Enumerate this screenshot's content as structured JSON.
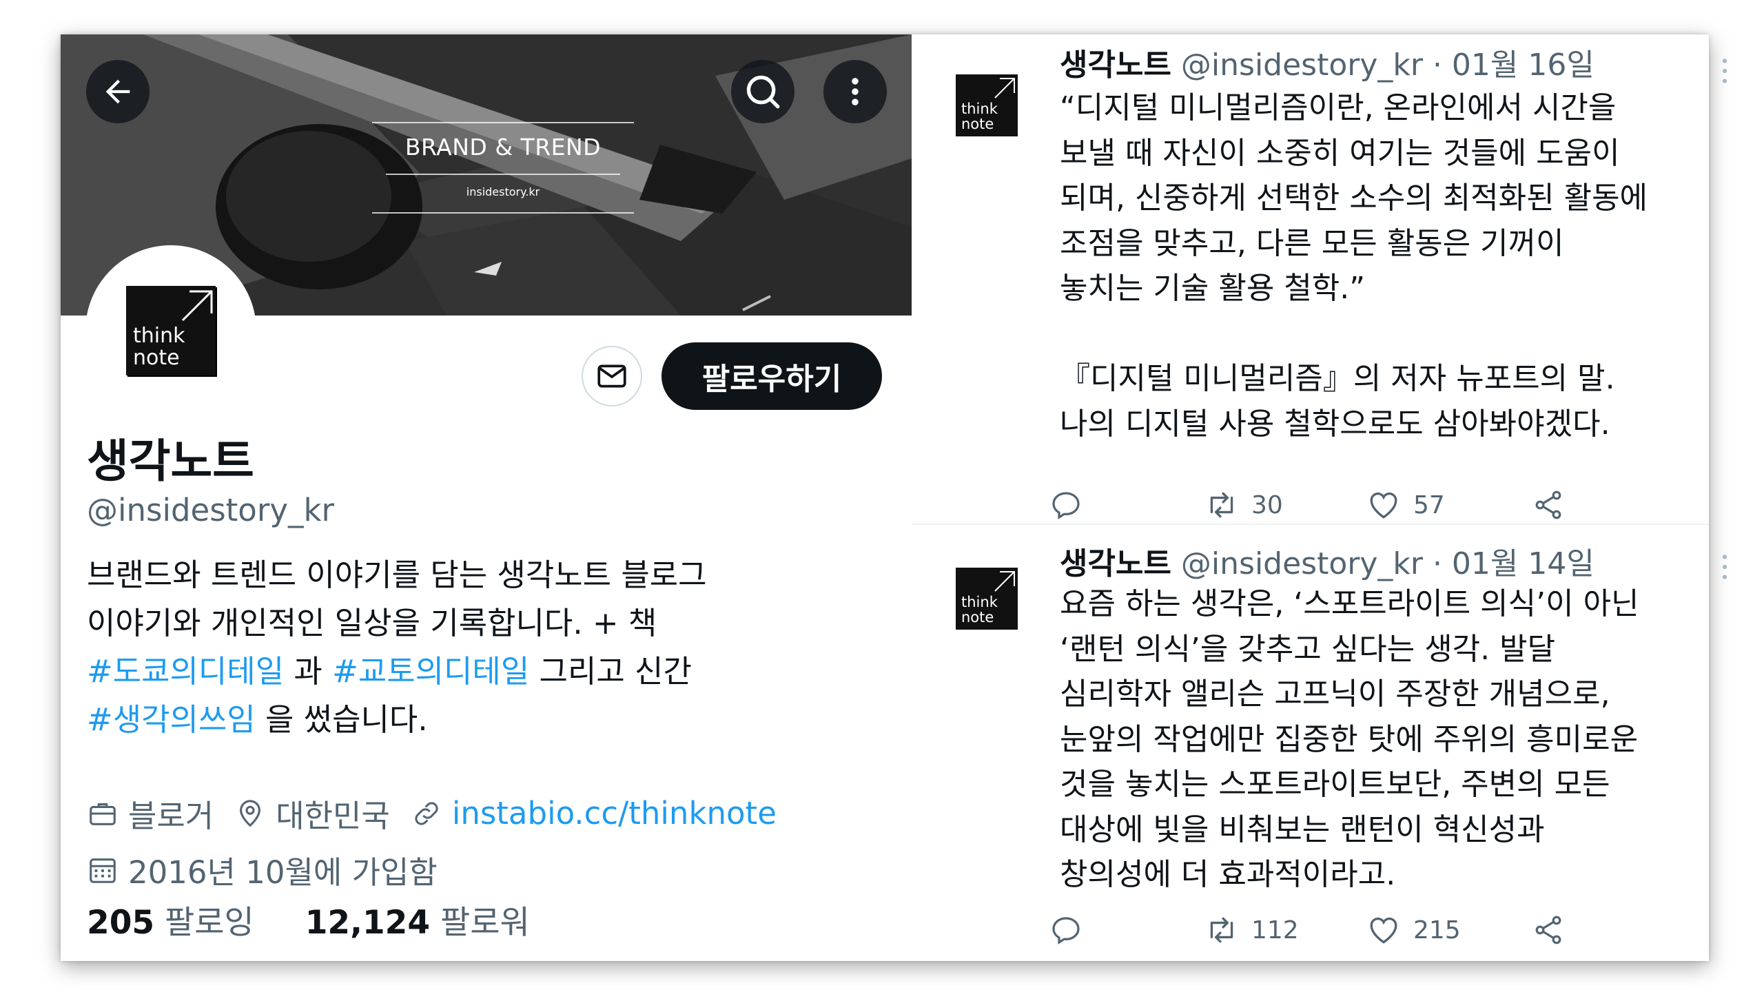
{
  "banner": {
    "title": "BRAND & TREND",
    "subtitle": "insidestory.kr"
  },
  "header_buttons": {
    "back_icon": "arrow-left-icon",
    "search_icon": "search-icon",
    "more_icon": "more-vertical-icon"
  },
  "avatar": {
    "logo_line1": "think",
    "logo_line2": "note"
  },
  "actions": {
    "message_icon": "mail-icon",
    "follow_label": "팔로우하기"
  },
  "profile": {
    "display_name": "생각노트",
    "handle": "@insidestory_kr",
    "bio": {
      "line1": "브랜드와 트렌드 이야기를 담는 생각노트 블로그",
      "line2": "이야기와 개인적인 일상을 기록합니다. + 책",
      "tag1": "#도쿄의디테일",
      "conj1": " 과 ",
      "tag2": "#교토의디테일",
      "tail1": " 그리고 신간",
      "tag3": "#생각의쓰임",
      "tail2": " 을 썼습니다."
    },
    "occupation": "블로거",
    "location": "대한민국",
    "website": "instabio.cc/thinknote",
    "joined": "2016년 10월에 가입함",
    "following_count": "205",
    "following_label": " 팔로잉",
    "followers_count": "12,124",
    "followers_label": " 팔로워"
  },
  "tweets": [
    {
      "name": "생각노트",
      "handle_date": " @insidestory_kr · 01월 16일",
      "lines": [
        "“디지털 미니멀리즘이란, 온라인에서 시간을",
        "보낼 때 자신이 소중히 여기는 것들에 도움이",
        "되며, 신중하게 선택한 소수의 최적화된 활동에",
        "조점을 맞추고, 다른 모든 활동은 기꺼이",
        "놓치는 기술 활용 철학.”",
        "",
        "『디지털 미니멀리즘』의 저자 뉴포트의 말.",
        "나의 디지털 사용 철학으로도 삼아봐야겠다."
      ],
      "retweets": "30",
      "likes": "57"
    },
    {
      "name": "생각노트",
      "handle_date": " @insidestory_kr · 01월 14일",
      "lines": [
        "요즘 하는 생각은, ‘스포트라이트 의식’이 아닌",
        "‘랜턴 의식’을 갖추고 싶다는 생각. 발달",
        "심리학자 앨리슨 고프닉이 주장한 개념으로,",
        "눈앞의 작업에만 집중한 탓에 주위의 흥미로운",
        "것을 놓치는 스포트라이트보단, 주변의 모든",
        "대상에 빛을 비춰보는 랜턴이 혁신성과",
        "창의성에 더 효과적이라고."
      ],
      "retweets": "112",
      "likes": "215"
    }
  ],
  "icons": {
    "reply": "reply-icon",
    "retweet": "retweet-icon",
    "like": "heart-icon",
    "share": "share-icon",
    "occupation": "briefcase-icon",
    "location": "location-pin-icon",
    "link": "link-icon",
    "calendar": "calendar-icon"
  }
}
